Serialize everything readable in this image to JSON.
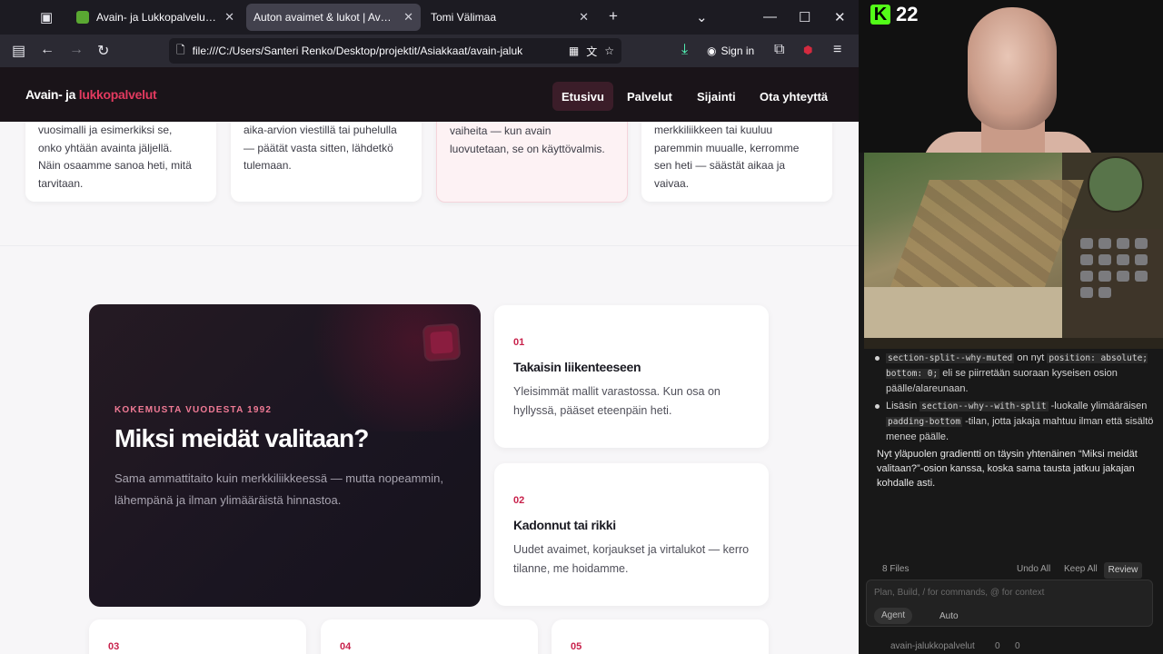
{
  "tabs": [
    {
      "label": "Avain- ja Lukkopalvelu Laune O",
      "favicon_color": "#5aa832",
      "active": false
    },
    {
      "label": "Auton avaimet & lukot | Avain- ja lu",
      "favicon_color": "",
      "active": true
    },
    {
      "label": "Tomi Välimaa",
      "favicon_color": "",
      "active": false
    }
  ],
  "url": "file:///C:/Users/Santeri Renko/Desktop/projektit/Asiakkaat/avain-jaluk",
  "signin_label": "Sign in",
  "site": {
    "logo_main": "Avain- ja ",
    "logo_accent": "lukkopalvelut",
    "nav": [
      "Etusivu",
      "Palvelut",
      "Sijainti",
      "Ota yhteyttä"
    ],
    "active_nav": "Etusivu"
  },
  "top_cards": [
    {
      "lines": [
        "vuosimalli ja esimerkiksi se,",
        "onko yhtään avainta jäljellä.",
        "Näin osaamme sanoa heti, mitä",
        "tarvitaan."
      ]
    },
    {
      "lines": [
        "aika-arvion viestillä tai puhelulla",
        "— päätät vasta sitten, lähdetkö",
        "tulemaan."
      ]
    },
    {
      "lines": [
        "vaiheita — kun avain",
        "luovutetaan, se on käyttövalmis."
      ]
    },
    {
      "lines": [
        "merkkiliikkeen tai kuuluu",
        "paremmin muualle, kerromme",
        "sen heti — säästät aikaa ja",
        "vaivaa."
      ]
    }
  ],
  "why": {
    "kicker": "KOKEMUSTA VUODESTA 1992",
    "title": "Miksi meidät valitaan?",
    "desc": "Sama ammattitaito kuin merkkiliikkeessä — mutta nopeammin, lähempänä ja ilman ylimääräistä hinnastoa."
  },
  "features": [
    {
      "num": "01",
      "title": "Takaisin liikenteeseen",
      "desc": "Yleisimmät mallit varastossa. Kun osa on hyllyssä, pääset eteenpäin heti."
    },
    {
      "num": "02",
      "title": "Kadonnut tai rikki",
      "desc": "Uudet avaimet, korjaukset ja virtalukot — kerro tilanne, me hoidamme."
    }
  ],
  "mini_cards": [
    "03",
    "04",
    "05"
  ],
  "stream": {
    "badge_number": "22"
  },
  "chat": {
    "b1_code": "section-split--why-muted",
    "b1_mid": " on nyt ",
    "b1_code2": "position: absolute; bottom: 0;",
    "b1_tail": " eli se piirretään suoraan kyseisen osion päälle/alareunaan.",
    "b2_pre": "Lisäsin ",
    "b2_code": "section--why--with-split",
    "b2_mid": " -luokalle ylimääräisen ",
    "b2_code2": "padding-bottom",
    "b2_tail": " -tilan, jotta jakaja mahtuu ilman että sisältö menee päälle.",
    "summary": "Nyt yläpuolen gradientti on täysin yhtenäinen “Miksi meidät valitaan?”-osion kanssa, koska sama tausta jatkuu jakajan kohdalle asti.",
    "files": "8 Files",
    "undo_all": "Undo All",
    "keep_all": "Keep All",
    "review": "Review",
    "placeholder": "Plan, Build, / for commands, @ for context",
    "agent": "Agent",
    "auto": "Auto",
    "project": "avain-jalukkopalvelut",
    "problems": "0",
    "warnings": "0"
  }
}
